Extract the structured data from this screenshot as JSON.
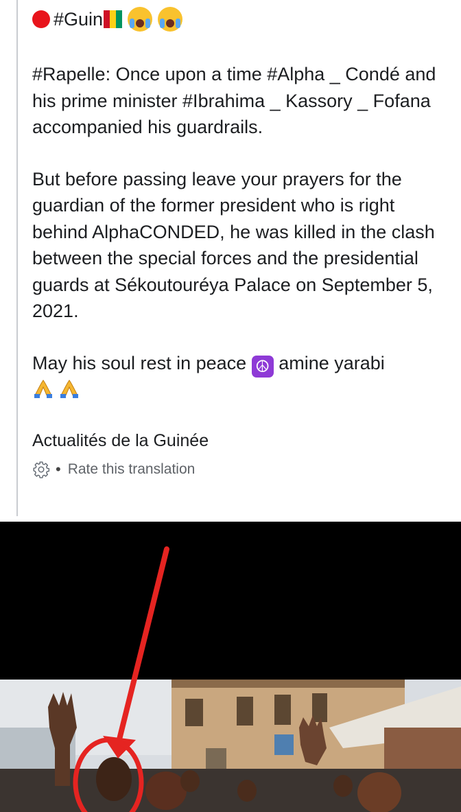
{
  "post": {
    "title_text": "#Guin",
    "paragraphs": [
      "#Rapelle: Once upon a time #Alpha _ Condé and his prime minister #Ibrahima _ Kassory _ Fofana accompanied his guardrails.",
      "But before passing leave your prayers for the guardian of the former president who is right behind AlphaCONDED, he was killed in the clash between the special forces and the presidential guards at Sékoutouréya Palace on September 5, 2021."
    ],
    "closing_text": "May his soul rest in peace",
    "closing_suffix": "amine yarabi",
    "source": "Actualités de la Guinée",
    "translation": {
      "separator": "•",
      "rate_label": "Rate this translation"
    },
    "icons": {
      "red_circle": "red-circle-emoji",
      "flag": "guinea-flag-emoji",
      "crying": "loudly-crying-face-emoji",
      "peace": "peace-symbol-emoji",
      "pray": "folded-hands-emoji",
      "gear": "gear-icon"
    }
  },
  "colors": {
    "red_arrow": "#e52421",
    "flag_red": "#ce1126",
    "flag_yellow": "#fcd116",
    "flag_green": "#009460",
    "peace_bg": "#8e3ad6"
  }
}
